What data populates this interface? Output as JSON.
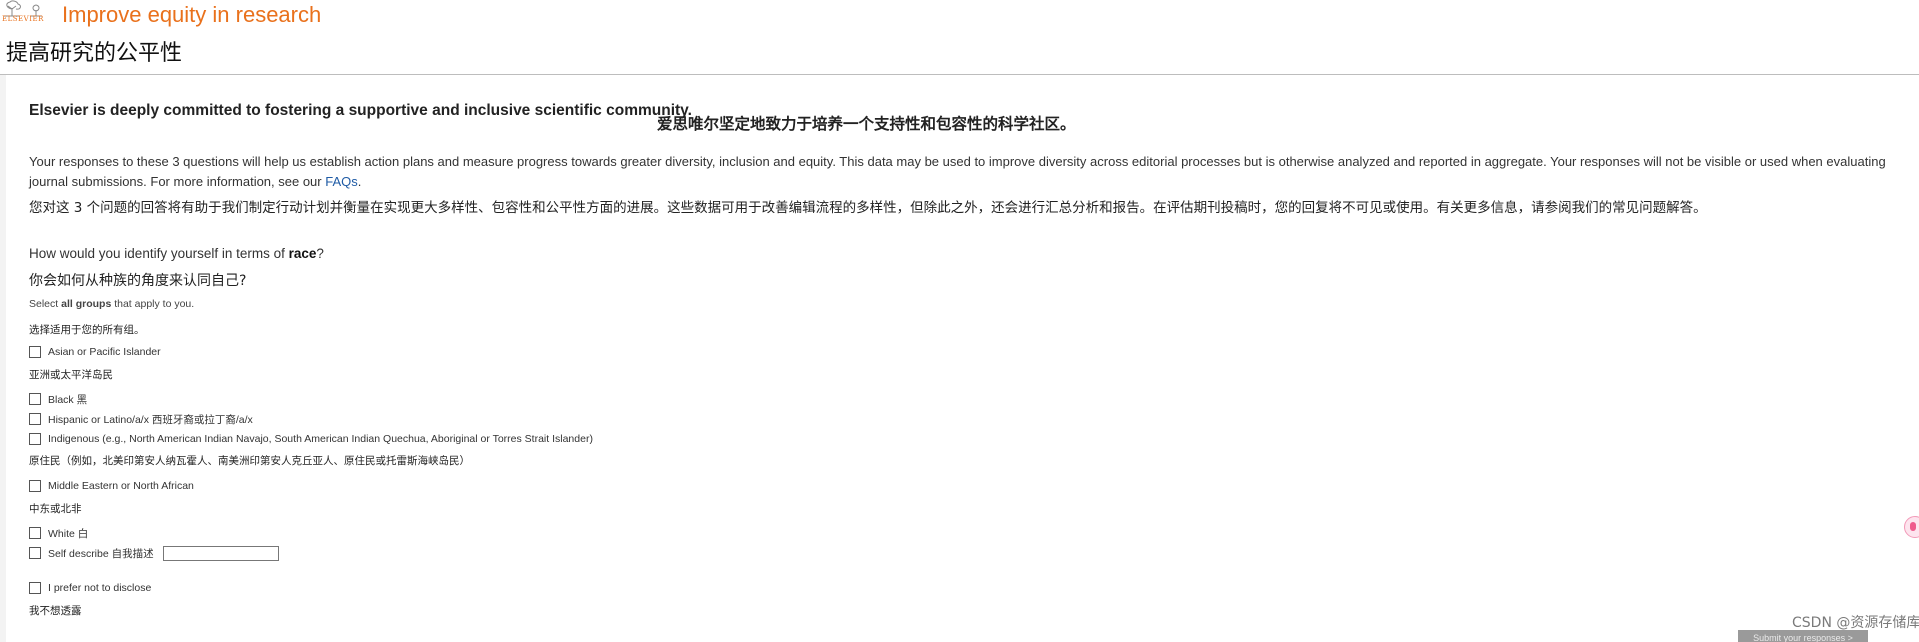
{
  "header": {
    "logo_text": "ELSEVIER",
    "title": "Improve equity in research",
    "title_zh": "提高研究的公平性"
  },
  "intro": {
    "lead_en": "Elsevier is deeply committed to fostering a supportive and inclusive scientific community.",
    "lead_zh": "爱思唯尔坚定地致力于培养一个支持性和包容性的科学社区。",
    "para_en": "Your responses to these 3 questions will help us establish action plans and measure progress towards greater diversity, inclusion and equity. This data may be used to improve diversity across editorial processes but is otherwise analyzed and reported in aggregate. Your responses will not be visible or used when evaluating journal submissions. For more information, see our ",
    "faq_link": "FAQs",
    "para_end": ".",
    "para_zh": "您对这 3 个问题的回答将有助于我们制定行动计划并衡量在实现更大多样性、包容性和公平性方面的进展。这些数据可用于改善编辑流程的多样性，但除此之外，还会进行汇总分析和报告。在评估期刊投稿时，您的回复将不可见或使用。有关更多信息，请参阅我们的常见问题解答。"
  },
  "question": {
    "prefix": "How would you identify yourself in terms of ",
    "keyword": "race",
    "suffix": "?",
    "zh": "你会如何从种族的角度来认同自己?",
    "hint_prefix": "Select ",
    "hint_bold": "all groups",
    "hint_suffix": " that apply to you.",
    "hint_zh": "选择适用于您的所有组。"
  },
  "options": {
    "asian": {
      "label": "Asian or Pacific Islander",
      "zh": "亚洲或太平洋岛民"
    },
    "black": {
      "label": "Black 黑"
    },
    "hispanic": {
      "label": "Hispanic or Latino/a/x 西班牙裔或拉丁裔/a/x"
    },
    "indigenous": {
      "label": "Indigenous (e.g., North American Indian Navajo, South American Indian Quechua, Aboriginal or Torres Strait Islander)",
      "zh": "原住民（例如，北美印第安人纳瓦霍人、南美洲印第安人克丘亚人、原住民或托雷斯海峡岛民）"
    },
    "mideast": {
      "label": "Middle Eastern or North African",
      "zh": "中东或北非"
    },
    "white": {
      "label": "White 白"
    },
    "self": {
      "label": "Self describe 自我描述",
      "value": ""
    },
    "prefer_not": {
      "label": "I prefer not to disclose",
      "zh": "我不想透露"
    }
  },
  "footer": {
    "watermark": "CSDN @资源存储库",
    "submit_label": "Submit your responses >"
  }
}
